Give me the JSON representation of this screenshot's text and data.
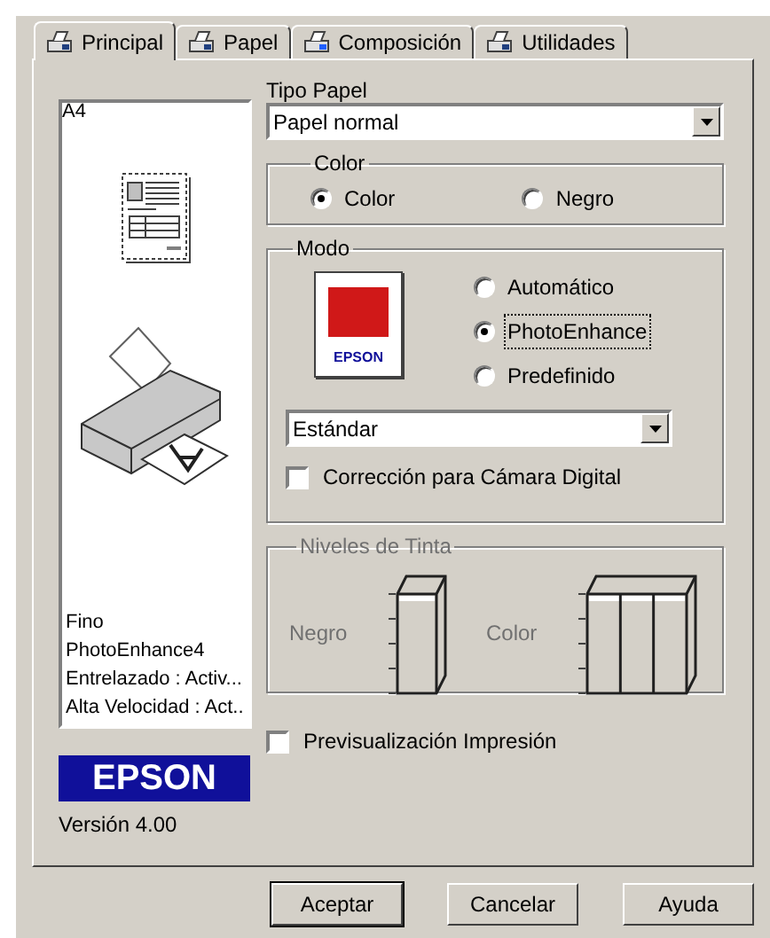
{
  "tabs": [
    {
      "label": "Principal",
      "selected": true
    },
    {
      "label": "Papel",
      "selected": false
    },
    {
      "label": "Composición",
      "selected": false
    },
    {
      "label": "Utilidades",
      "selected": false
    }
  ],
  "preview": {
    "paper_size": "A4",
    "info": [
      "Fino",
      "PhotoEnhance4",
      "Entrelazado : Activ...",
      "Alta Velocidad : Act.."
    ]
  },
  "logo": "EPSON",
  "version": "Versión 4.00",
  "paper_type": {
    "label": "Tipo Papel",
    "value": "Papel normal"
  },
  "color": {
    "title": "Color",
    "options": [
      {
        "label": "Color",
        "selected": true
      },
      {
        "label": "Negro",
        "selected": false
      }
    ]
  },
  "mode": {
    "title": "Modo",
    "thumbnail_brand": "EPSON",
    "options": [
      {
        "label": "Automático",
        "selected": false,
        "focused": false
      },
      {
        "label": "PhotoEnhance",
        "selected": true,
        "focused": true
      },
      {
        "label": "Predefinido",
        "selected": false,
        "focused": false
      }
    ],
    "preset": "Estándar",
    "digital_camera": {
      "label": "Corrección para Cámara Digital",
      "checked": false
    }
  },
  "ink_levels": {
    "title": "Niveles de Tinta",
    "disabled": true,
    "labels": [
      "Negro",
      "Color"
    ]
  },
  "print_preview": {
    "label": "Previsualización Impresión",
    "checked": false
  },
  "buttons": [
    {
      "label": "Aceptar",
      "default": true
    },
    {
      "label": "Cancelar",
      "default": false
    },
    {
      "label": "Ayuda",
      "default": false
    }
  ]
}
